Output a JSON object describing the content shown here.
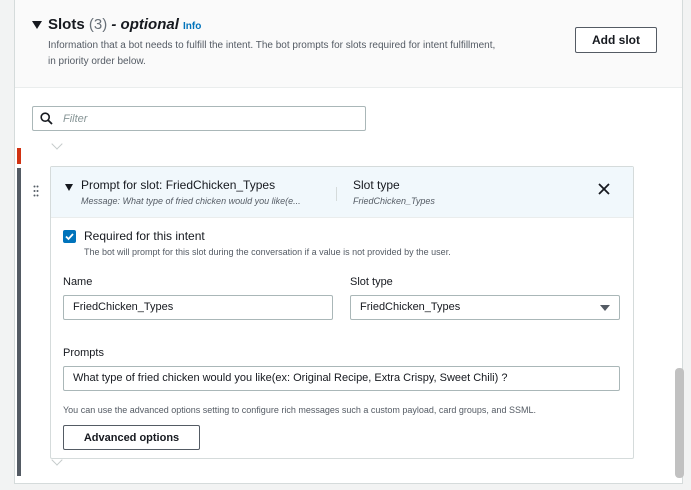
{
  "section": {
    "title": "Slots",
    "count": "(3)",
    "optional": "- optional",
    "info_link": "Info",
    "description": "Information that a bot needs to fulfill the intent. The bot prompts for slots required for intent fulfillment, in priority order below.",
    "add_slot_label": "Add slot"
  },
  "filter": {
    "placeholder": "Filter",
    "value": ""
  },
  "slot": {
    "header": {
      "prompt_title": "Prompt for slot: FriedChicken_Types",
      "message_preview": "Message: What type of fried chicken would you like(e...",
      "slot_type_label": "Slot type",
      "slot_type_value": "FriedChicken_Types"
    },
    "required": {
      "checked": true,
      "label": "Required for this intent",
      "description": "The bot will prompt for this slot during the conversation if a value is not provided by the user."
    },
    "name_label": "Name",
    "name_value": "FriedChicken_Types",
    "slot_type_field_label": "Slot type",
    "slot_type_field_value": "FriedChicken_Types",
    "prompts_label": "Prompts",
    "prompts_value": "What type of fried chicken would you like(ex: Original Recipe, Extra Crispy, Sweet Chili) ?",
    "advanced_text": "You can use the advanced options setting to configure rich messages such a custom payload, card groups, and SSML.",
    "advanced_button": "Advanced options"
  },
  "colors": {
    "accent": "#0073bb",
    "error_bar": "#d13212",
    "card_header_bg": "#f1f8fc"
  },
  "icons": {
    "search": "search-icon",
    "close": "close-icon",
    "drag": "drag-handle-icon",
    "check": "check-icon",
    "expand": "caret-down-icon",
    "select": "caret-down-icon"
  }
}
